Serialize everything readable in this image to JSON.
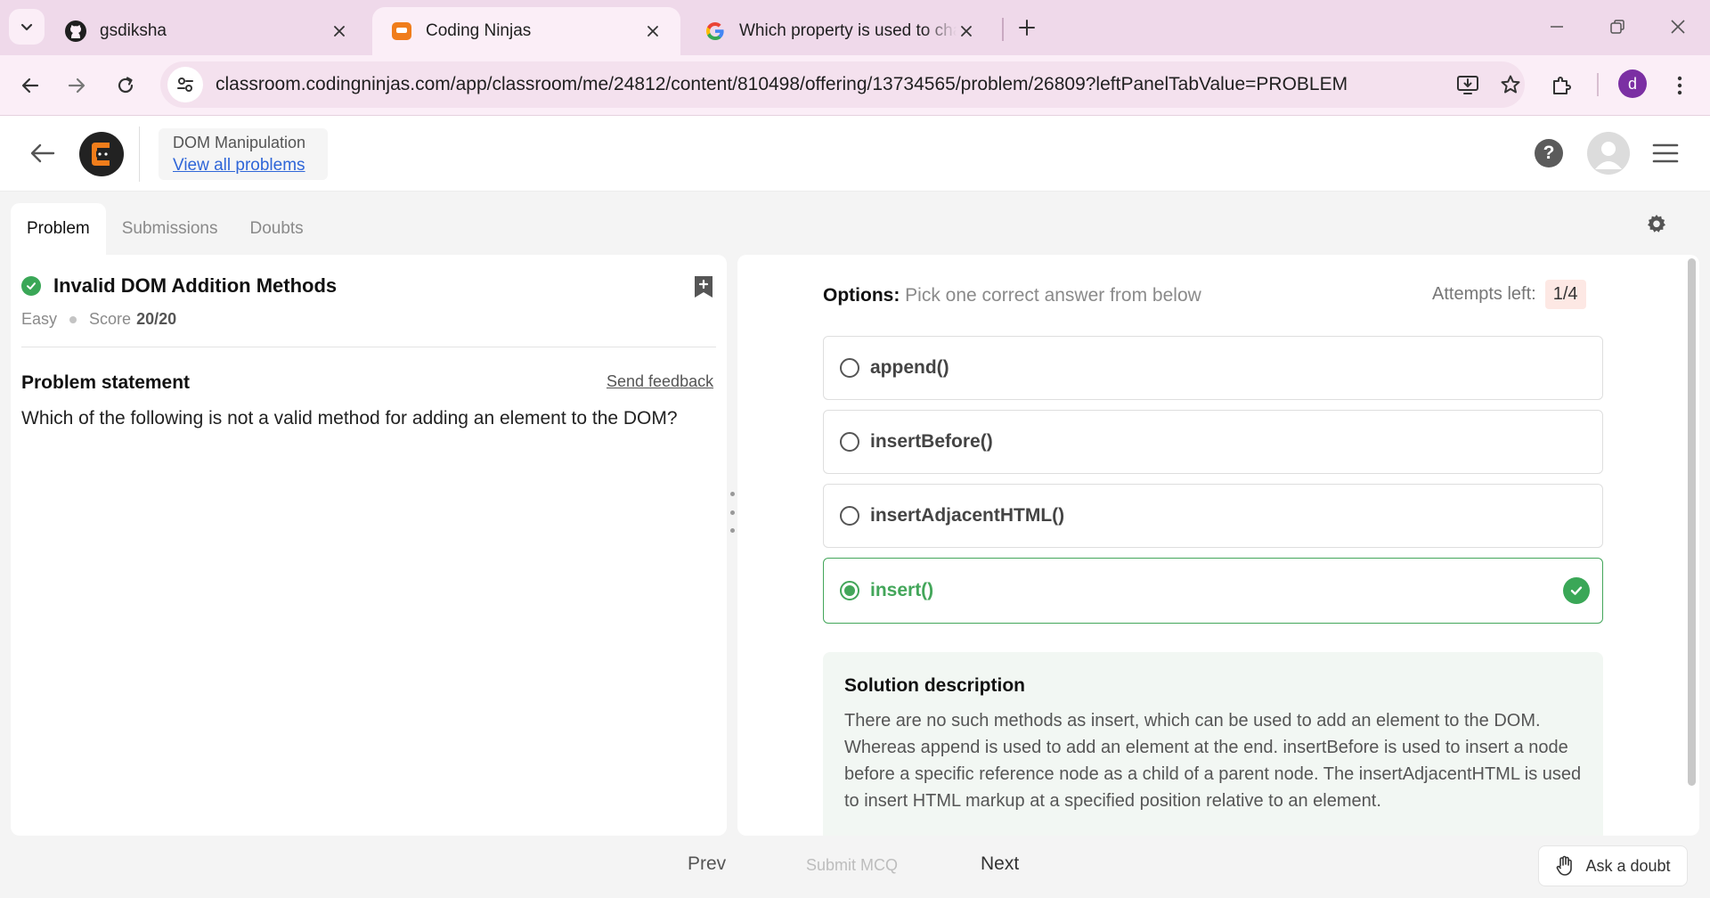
{
  "browser": {
    "tabs": [
      {
        "title": "gsdiksha",
        "icon": "github-icon"
      },
      {
        "title": "Coding Ninjas",
        "icon": "coding-ninjas-icon",
        "active": true
      },
      {
        "title": "Which property is used to chan",
        "icon": "google-icon"
      }
    ],
    "url": "classroom.codingninjas.com/app/classroom/me/24812/content/810498/offering/13734565/problem/26809?leftPanelTabValue=PROBLEM",
    "profile_initial": "d"
  },
  "header": {
    "section_title": "DOM Manipulation",
    "view_all_label": "View all problems",
    "help_label": "?"
  },
  "left_tabs": [
    {
      "label": "Problem",
      "active": true
    },
    {
      "label": "Submissions"
    },
    {
      "label": "Doubts"
    }
  ],
  "problem": {
    "title": "Invalid DOM Addition Methods",
    "difficulty": "Easy",
    "score_label": "Score",
    "score_value": "20/20",
    "statement_label": "Problem statement",
    "feedback_label": "Send feedback",
    "question": "Which of the following is not a valid method for adding an element to the DOM?"
  },
  "options_panel": {
    "label": "Options:",
    "sublabel": "Pick one correct answer from below",
    "attempts_label": "Attempts left:",
    "attempts_value": "1/4",
    "options": [
      {
        "text": "append()"
      },
      {
        "text": "insertBefore()"
      },
      {
        "text": "insertAdjacentHTML()"
      },
      {
        "text": "insert()",
        "selected": true,
        "correct": true
      }
    ]
  },
  "solution": {
    "title": "Solution description",
    "text": "There are no such methods as insert, which can be used to add an element to the DOM. Whereas append is used to add an element at the end. insertBefore is used to insert a node before a specific reference node as a child of a parent node. The insertAdjacentHTML is used to insert HTML markup at a specified position relative to an element."
  },
  "footer": {
    "prev_label": "Prev",
    "submit_label": "Submit MCQ",
    "next_label": "Next",
    "ask_label": "Ask a doubt"
  },
  "colors": {
    "success": "#3aa757",
    "link": "#2f66d8",
    "brand_orange": "#f07d1b",
    "chrome_tabbar": "#efd9ea"
  }
}
